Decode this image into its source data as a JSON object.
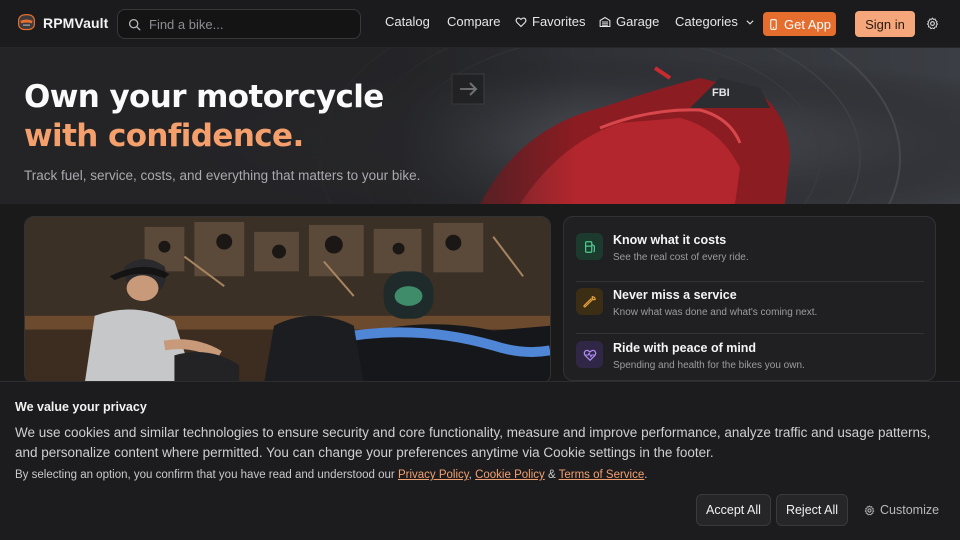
{
  "brand": {
    "name": "RPMVault",
    "logo_icon": "helmet-logo-icon"
  },
  "search": {
    "placeholder": "Find a bike..."
  },
  "nav": {
    "catalog": "Catalog",
    "compare": "Compare",
    "favorites": "Favorites",
    "garage": "Garage",
    "categories": "Categories",
    "get_app": "Get App",
    "sign_in": "Sign in"
  },
  "hero": {
    "title_line1": "Own your motorcycle",
    "title_line2": "with confidence.",
    "subtitle": "Track fuel, service, costs, and everything that matters to your bike."
  },
  "features": [
    {
      "title": "Know what it costs",
      "desc": "See the real cost of every ride.",
      "icon": "fuel-pump-icon",
      "color": "#4ecb8d"
    },
    {
      "title": "Never miss a service",
      "desc": "Know what was done and what's coming next.",
      "icon": "wrench-icon",
      "color": "#e9a23b"
    },
    {
      "title": "Ride with peace of mind",
      "desc": "Spending and health for the bikes you own.",
      "icon": "heart-pulse-icon",
      "color": "#b38cf5"
    }
  ],
  "cookie": {
    "title": "We value your privacy",
    "body": "We use cookies and similar technologies to ensure security and core functionality, measure and improve performance, analyze traffic and usage patterns, and personalize content where permitted. You can change your preferences anytime via Cookie settings in the footer.",
    "legal_prefix": "By selecting an option, you confirm that you have read and understood our",
    "privacy_link": "Privacy Policy",
    "sep_comma": ",",
    "cookie_link": "Cookie Policy",
    "sep_amp": "&",
    "terms_link": "Terms of Service",
    "legal_suffix": ".",
    "accept": "Accept All",
    "reject": "Reject All",
    "customize": "Customize"
  },
  "colors": {
    "accent": "#e56e2e",
    "accent_light": "#f5a67a",
    "hero_highlight": "#f5a06c"
  }
}
